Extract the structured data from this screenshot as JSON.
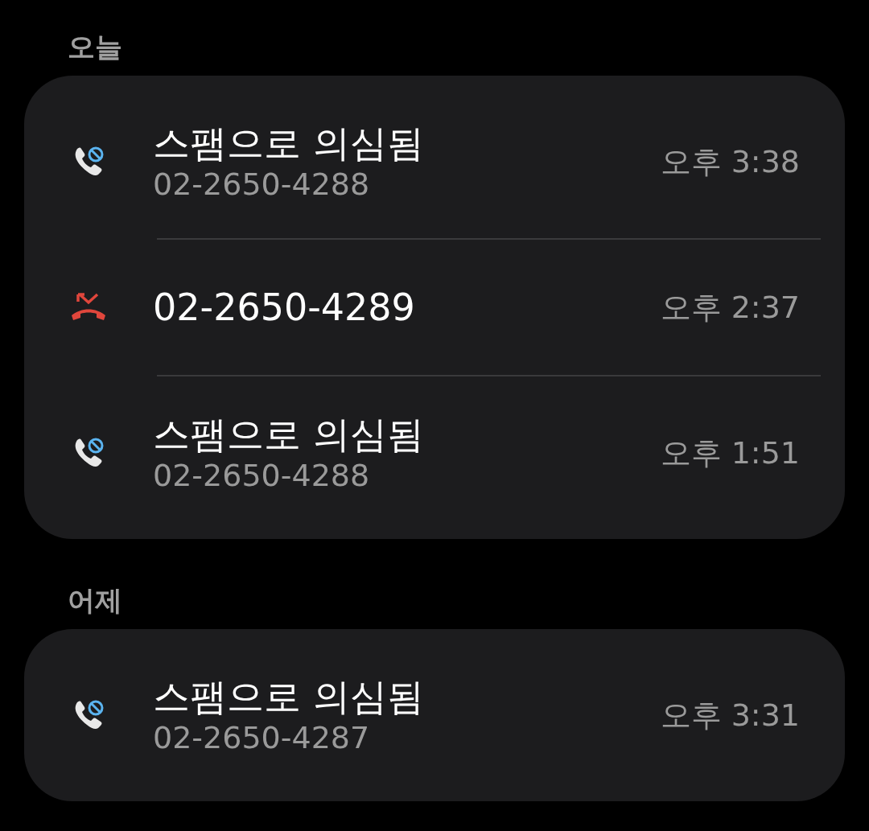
{
  "sections": [
    {
      "heading": "오늘",
      "calls": [
        {
          "kind": "spam",
          "title": "스팸으로 의심됨",
          "number": "02-2650-4288",
          "time": "오후 3:38"
        },
        {
          "kind": "missed",
          "title": "02-2650-4289",
          "time": "오후 2:37"
        },
        {
          "kind": "spam",
          "title": "스팸으로 의심됨",
          "number": "02-2650-4288",
          "time": "오후 1:51"
        }
      ]
    },
    {
      "heading": "어제",
      "calls": [
        {
          "kind": "spam",
          "title": "스팸으로 의심됨",
          "number": "02-2650-4287",
          "time": "오후 3:31"
        }
      ]
    }
  ]
}
